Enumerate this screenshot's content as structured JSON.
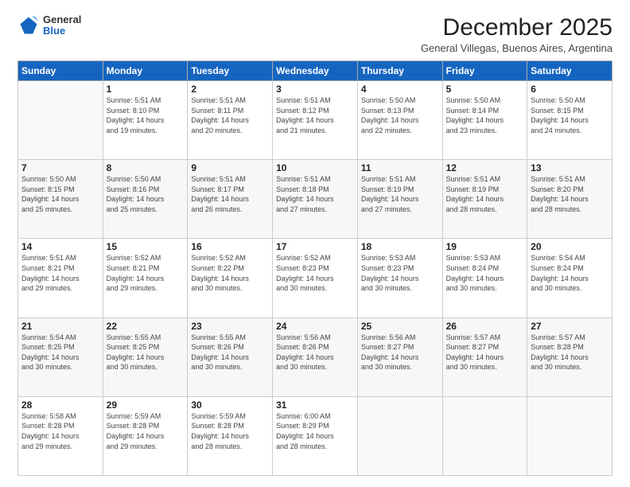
{
  "header": {
    "logo": {
      "general": "General",
      "blue": "Blue"
    },
    "title": "December 2025",
    "subtitle": "General Villegas, Buenos Aires, Argentina"
  },
  "calendar": {
    "headers": [
      "Sunday",
      "Monday",
      "Tuesday",
      "Wednesday",
      "Thursday",
      "Friday",
      "Saturday"
    ],
    "weeks": [
      [
        {
          "day": "",
          "info": ""
        },
        {
          "day": "1",
          "info": "Sunrise: 5:51 AM\nSunset: 8:10 PM\nDaylight: 14 hours\nand 19 minutes."
        },
        {
          "day": "2",
          "info": "Sunrise: 5:51 AM\nSunset: 8:11 PM\nDaylight: 14 hours\nand 20 minutes."
        },
        {
          "day": "3",
          "info": "Sunrise: 5:51 AM\nSunset: 8:12 PM\nDaylight: 14 hours\nand 21 minutes."
        },
        {
          "day": "4",
          "info": "Sunrise: 5:50 AM\nSunset: 8:13 PM\nDaylight: 14 hours\nand 22 minutes."
        },
        {
          "day": "5",
          "info": "Sunrise: 5:50 AM\nSunset: 8:14 PM\nDaylight: 14 hours\nand 23 minutes."
        },
        {
          "day": "6",
          "info": "Sunrise: 5:50 AM\nSunset: 8:15 PM\nDaylight: 14 hours\nand 24 minutes."
        }
      ],
      [
        {
          "day": "7",
          "info": "Sunrise: 5:50 AM\nSunset: 8:15 PM\nDaylight: 14 hours\nand 25 minutes."
        },
        {
          "day": "8",
          "info": "Sunrise: 5:50 AM\nSunset: 8:16 PM\nDaylight: 14 hours\nand 25 minutes."
        },
        {
          "day": "9",
          "info": "Sunrise: 5:51 AM\nSunset: 8:17 PM\nDaylight: 14 hours\nand 26 minutes."
        },
        {
          "day": "10",
          "info": "Sunrise: 5:51 AM\nSunset: 8:18 PM\nDaylight: 14 hours\nand 27 minutes."
        },
        {
          "day": "11",
          "info": "Sunrise: 5:51 AM\nSunset: 8:19 PM\nDaylight: 14 hours\nand 27 minutes."
        },
        {
          "day": "12",
          "info": "Sunrise: 5:51 AM\nSunset: 8:19 PM\nDaylight: 14 hours\nand 28 minutes."
        },
        {
          "day": "13",
          "info": "Sunrise: 5:51 AM\nSunset: 8:20 PM\nDaylight: 14 hours\nand 28 minutes."
        }
      ],
      [
        {
          "day": "14",
          "info": "Sunrise: 5:51 AM\nSunset: 8:21 PM\nDaylight: 14 hours\nand 29 minutes."
        },
        {
          "day": "15",
          "info": "Sunrise: 5:52 AM\nSunset: 8:21 PM\nDaylight: 14 hours\nand 29 minutes."
        },
        {
          "day": "16",
          "info": "Sunrise: 5:52 AM\nSunset: 8:22 PM\nDaylight: 14 hours\nand 30 minutes."
        },
        {
          "day": "17",
          "info": "Sunrise: 5:52 AM\nSunset: 8:23 PM\nDaylight: 14 hours\nand 30 minutes."
        },
        {
          "day": "18",
          "info": "Sunrise: 5:53 AM\nSunset: 8:23 PM\nDaylight: 14 hours\nand 30 minutes."
        },
        {
          "day": "19",
          "info": "Sunrise: 5:53 AM\nSunset: 8:24 PM\nDaylight: 14 hours\nand 30 minutes."
        },
        {
          "day": "20",
          "info": "Sunrise: 5:54 AM\nSunset: 8:24 PM\nDaylight: 14 hours\nand 30 minutes."
        }
      ],
      [
        {
          "day": "21",
          "info": "Sunrise: 5:54 AM\nSunset: 8:25 PM\nDaylight: 14 hours\nand 30 minutes."
        },
        {
          "day": "22",
          "info": "Sunrise: 5:55 AM\nSunset: 8:25 PM\nDaylight: 14 hours\nand 30 minutes."
        },
        {
          "day": "23",
          "info": "Sunrise: 5:55 AM\nSunset: 8:26 PM\nDaylight: 14 hours\nand 30 minutes."
        },
        {
          "day": "24",
          "info": "Sunrise: 5:56 AM\nSunset: 8:26 PM\nDaylight: 14 hours\nand 30 minutes."
        },
        {
          "day": "25",
          "info": "Sunrise: 5:56 AM\nSunset: 8:27 PM\nDaylight: 14 hours\nand 30 minutes."
        },
        {
          "day": "26",
          "info": "Sunrise: 5:57 AM\nSunset: 8:27 PM\nDaylight: 14 hours\nand 30 minutes."
        },
        {
          "day": "27",
          "info": "Sunrise: 5:57 AM\nSunset: 8:28 PM\nDaylight: 14 hours\nand 30 minutes."
        }
      ],
      [
        {
          "day": "28",
          "info": "Sunrise: 5:58 AM\nSunset: 8:28 PM\nDaylight: 14 hours\nand 29 minutes."
        },
        {
          "day": "29",
          "info": "Sunrise: 5:59 AM\nSunset: 8:28 PM\nDaylight: 14 hours\nand 29 minutes."
        },
        {
          "day": "30",
          "info": "Sunrise: 5:59 AM\nSunset: 8:28 PM\nDaylight: 14 hours\nand 28 minutes."
        },
        {
          "day": "31",
          "info": "Sunrise: 6:00 AM\nSunset: 8:29 PM\nDaylight: 14 hours\nand 28 minutes."
        },
        {
          "day": "",
          "info": ""
        },
        {
          "day": "",
          "info": ""
        },
        {
          "day": "",
          "info": ""
        }
      ]
    ]
  }
}
